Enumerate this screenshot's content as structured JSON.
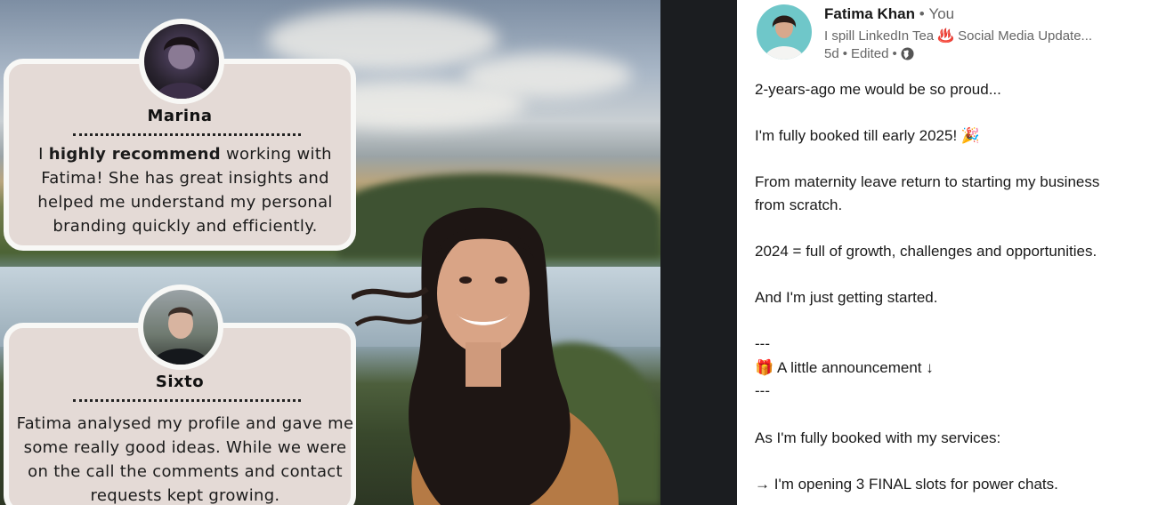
{
  "testimonials": [
    {
      "name": "Marina",
      "body_pre": "I ",
      "body_bold": "highly recommend",
      "body_post": " working with Fatima! She has great insights and helped me understand my personal branding quickly and efficiently."
    },
    {
      "name": "Sixto",
      "body": "Fatima analysed my profile and gave me some really good ideas. While we were on the call the comments and contact requests kept growing."
    }
  ],
  "post": {
    "author_name": "Fatima Khan",
    "separator": "•",
    "relation": "You",
    "headline": "I spill LinkedIn Tea ♨️ Social Media Update...",
    "time": "5d",
    "edited": "Edited",
    "lines": [
      "2-years-ago me would be so proud...",
      "I'm fully booked till early 2025! 🎉",
      "From maternity leave return to starting my business",
      "from scratch.",
      "2024 = full of growth, challenges and opportunities.",
      "And I'm just getting started.",
      "---",
      "🎁 A little announcement ↓",
      "---",
      "As I'm fully booked with my services:",
      "→ I'm opening 3 FINAL slots for power chats."
    ]
  },
  "colors": {
    "card_bg": "#e4dad6",
    "card_border": "#f8f8f6",
    "divider": "#1b1d20",
    "muted_text": "#666666"
  },
  "icons": [
    "globe-icon",
    "more-options-icon"
  ]
}
